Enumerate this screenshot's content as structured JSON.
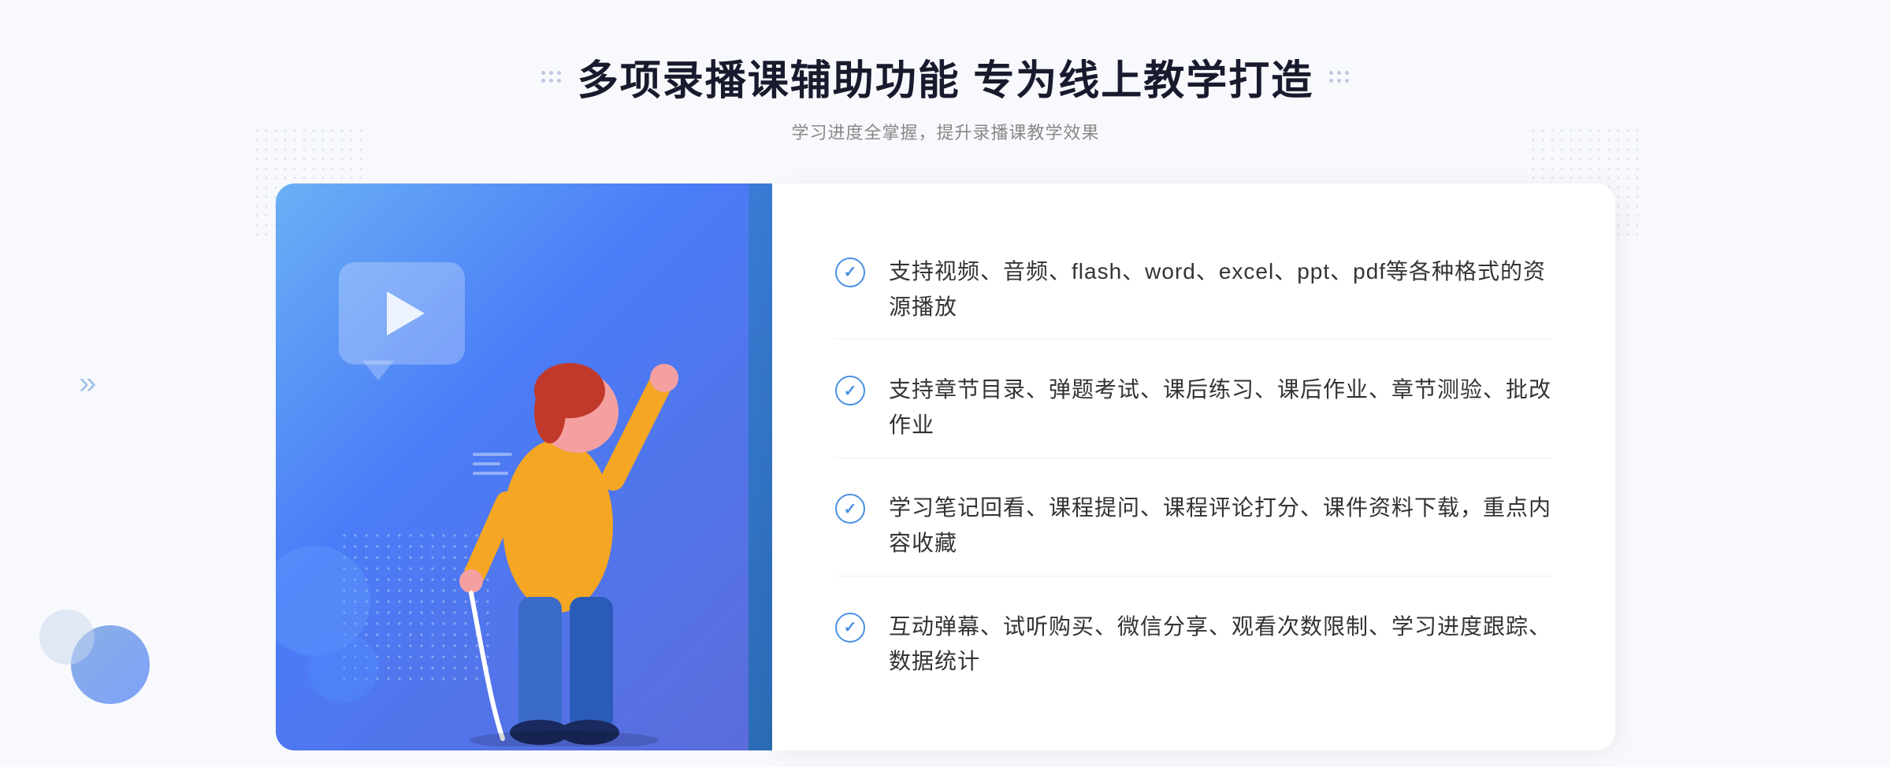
{
  "header": {
    "title": "多项录播课辅助功能 专为线上教学打造",
    "subtitle": "学习进度全掌握，提升录播课教学效果"
  },
  "features": [
    {
      "id": "feature-1",
      "text": "支持视频、音频、flash、word、excel、ppt、pdf等各种格式的资源播放"
    },
    {
      "id": "feature-2",
      "text": "支持章节目录、弹题考试、课后练习、课后作业、章节测验、批改作业"
    },
    {
      "id": "feature-3",
      "text": "学习笔记回看、课程提问、课程评论打分、课件资料下载，重点内容收藏"
    },
    {
      "id": "feature-4",
      "text": "互动弹幕、试听购买、微信分享、观看次数限制、学习进度跟踪、数据统计"
    }
  ],
  "icons": {
    "check": "✓",
    "play": "▶",
    "chevron": "»"
  }
}
